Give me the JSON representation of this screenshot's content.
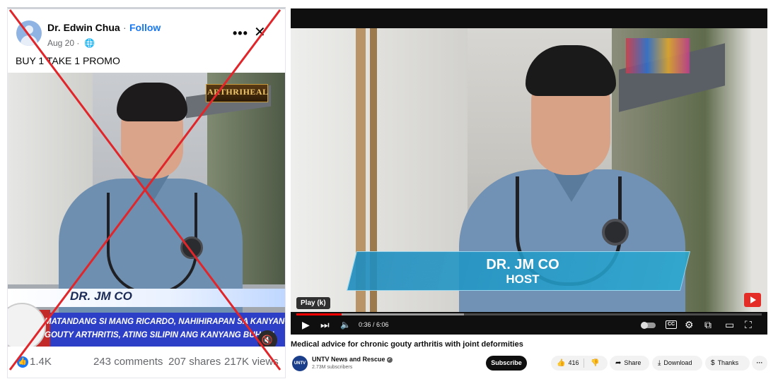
{
  "facebook": {
    "author": "Dr. Edwin Chua",
    "separator": "·",
    "follow_label": "Follow",
    "date": "Aug 20 ·",
    "post_text": "BUY 1 TAKE 1 PROMO",
    "video_logo_text": "ARTHRIHEAL",
    "lower_third_name": "DR. JM CO",
    "ticker_line1": "MATANDANG SI MANG RICARDO, NAHIHIRAPAN SA KANYANG",
    "ticker_line2": "GOUTY ARTHRITIS, ATING SILIPIN ANG KANYANG BUHAY!",
    "reactions": "1.4K",
    "comments": "243 comments",
    "shares": "207 shares",
    "views": "217K views",
    "crossed_out_color": "#e0262a"
  },
  "youtube": {
    "lower_third_name": "DR. JM CO",
    "lower_third_role": "HOST",
    "tooltip": "Play (k)",
    "time": "0:36 / 6:06",
    "progress_fraction": 0.098,
    "buffered_fraction": 0.36,
    "cc_label": "CC",
    "video_title": "Medical advice for chronic gouty arthritis with joint deformities",
    "channel_avatar_text": "UNTV",
    "channel_name": "UNTV News and Rescue",
    "subscribers": "2.73M subscribers",
    "subscribe_label": "Subscribe",
    "likes": "416",
    "share_label": "Share",
    "download_label": "Download",
    "thanks_label": "Thanks",
    "more_label": "···",
    "accent_color": "#ff0000"
  }
}
